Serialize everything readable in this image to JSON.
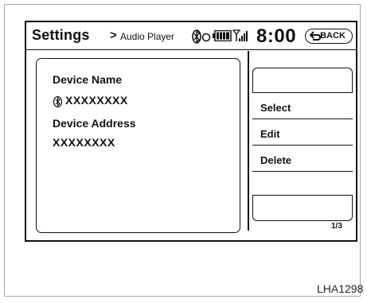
{
  "header": {
    "title": "Settings",
    "separator": ">",
    "breadcrumb": "Audio Player",
    "clock": "8:00",
    "back_label": "BACK"
  },
  "status_icons": [
    "bluetooth-icon",
    "battery-icon",
    "signal-icon"
  ],
  "device": {
    "name_label": "Device Name",
    "name_value": "XXXXXXXX",
    "address_label": "Device Address",
    "address_value": "XXXXXXXX"
  },
  "menu": {
    "items": [
      {
        "label": ""
      },
      {
        "label": "Select"
      },
      {
        "label": "Edit"
      },
      {
        "label": "Delete"
      },
      {
        "label": ""
      },
      {
        "label": ""
      }
    ]
  },
  "pagination": "1/3",
  "figure_code": "LHA1298"
}
